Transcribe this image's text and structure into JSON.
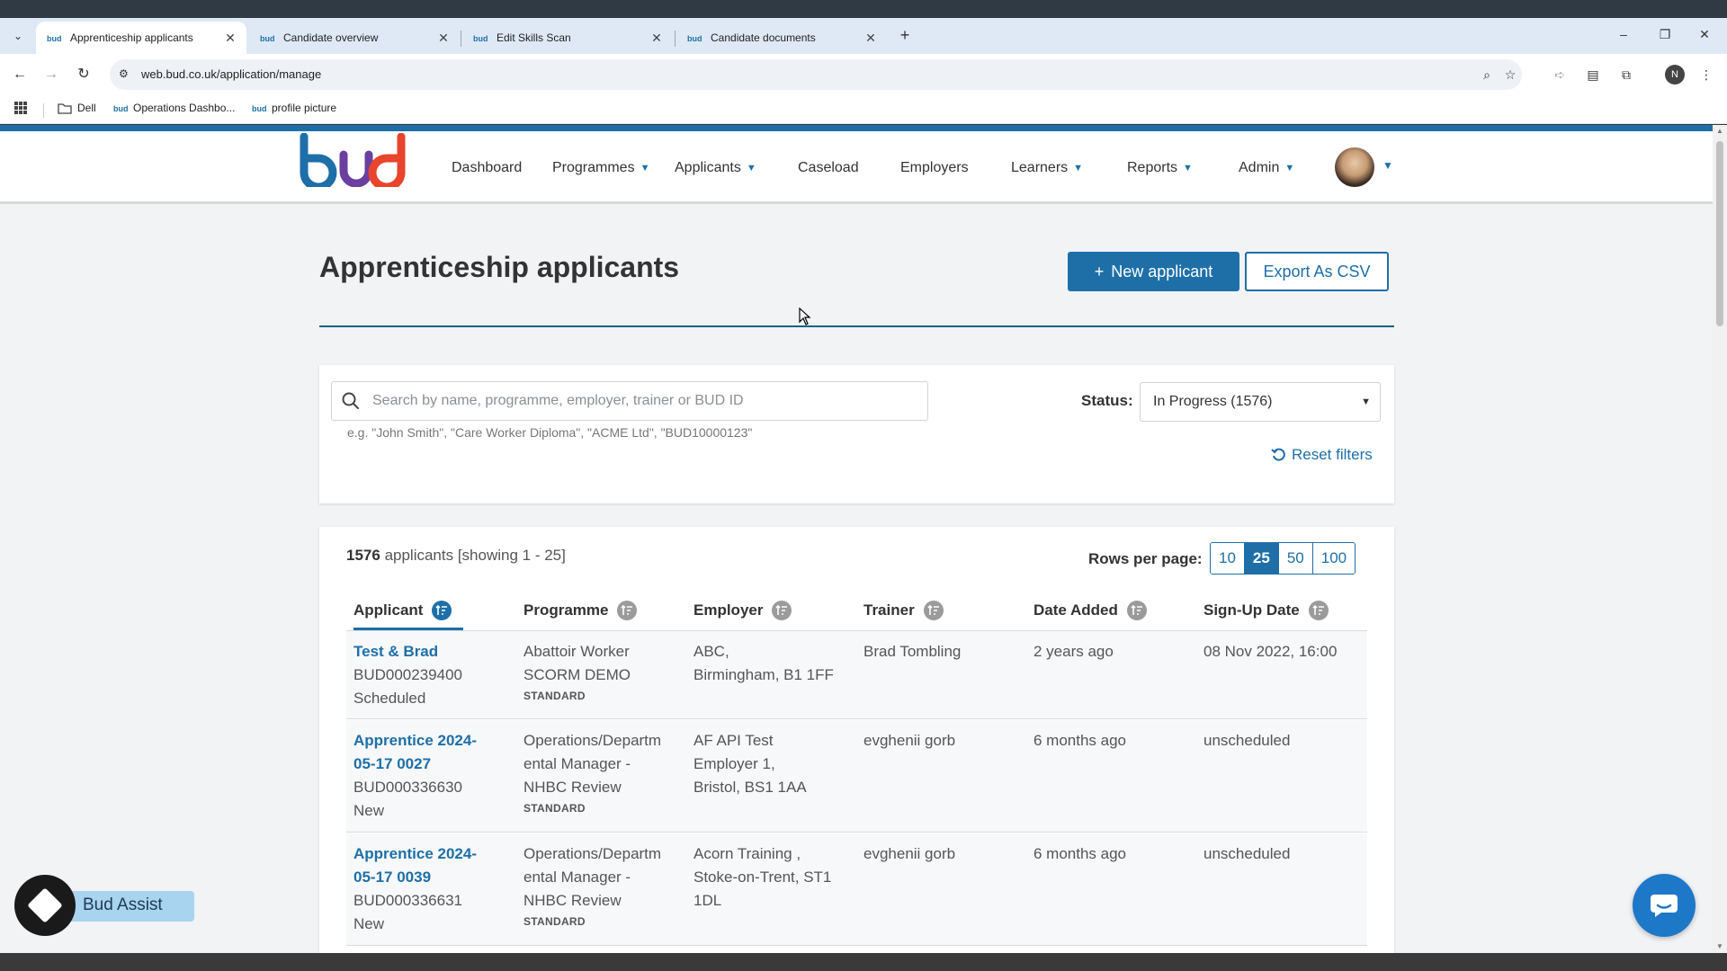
{
  "browser": {
    "tabs": [
      {
        "title": "Apprenticeship applicants",
        "active": true
      },
      {
        "title": "Candidate overview",
        "active": false
      },
      {
        "title": "Edit Skills Scan",
        "active": false
      },
      {
        "title": "Candidate documents",
        "active": false
      }
    ],
    "url": "web.bud.co.uk/application/manage",
    "profile_initial": "N",
    "bookmarks": [
      {
        "label": "Dell",
        "icon": "folder-icon"
      },
      {
        "label": "Operations Dashbo...",
        "icon": "bud-favicon"
      },
      {
        "label": "profile picture",
        "icon": "bud-favicon"
      }
    ]
  },
  "header": {
    "nav": [
      {
        "label": "Dashboard",
        "has_menu": false
      },
      {
        "label": "Programmes",
        "has_menu": true
      },
      {
        "label": "Applicants",
        "has_menu": true
      },
      {
        "label": "Caseload",
        "has_menu": false
      },
      {
        "label": "Employers",
        "has_menu": false
      },
      {
        "label": "Learners",
        "has_menu": true
      },
      {
        "label": "Reports",
        "has_menu": true
      },
      {
        "label": "Admin",
        "has_menu": true
      }
    ]
  },
  "page": {
    "title": "Apprenticeship applicants",
    "new_applicant": "New applicant",
    "export_csv": "Export As CSV"
  },
  "filters": {
    "search_placeholder": "Search by name, programme, employer, trainer or BUD ID",
    "search_value": "",
    "search_hint": "e.g. \"John Smith\", \"Care Worker Diploma\", \"ACME Ltd\", \"BUD10000123\"",
    "status_label": "Status:",
    "status_value": "In Progress (1576)",
    "reset_label": "Reset filters"
  },
  "table": {
    "count": "1576",
    "count_suffix": "applicants [showing 1 - 25]",
    "rows_per_page_label": "Rows per page:",
    "rows_per_page_options": [
      "10",
      "25",
      "50",
      "100"
    ],
    "rows_per_page_selected": "25",
    "columns": [
      "Applicant",
      "Programme",
      "Employer",
      "Trainer",
      "Date Added",
      "Sign-Up Date"
    ],
    "sorted_column": "Applicant",
    "rows": [
      {
        "applicant_lines": [
          "Test & Brad"
        ],
        "bud_id": "BUD000239400",
        "status": "Scheduled",
        "programme_lines": [
          "Abattoir Worker",
          "SCORM DEMO"
        ],
        "programme_tag": "STANDARD",
        "employer_lines": [
          "ABC,",
          "Birmingham, B1 1FF"
        ],
        "trainer": "Brad Tombling",
        "date_added": "2 years ago",
        "signup_date": "08 Nov 2022, 16:00"
      },
      {
        "applicant_lines": [
          "Apprentice 2024-",
          "05-17 0027"
        ],
        "bud_id": "BUD000336630",
        "status": "New",
        "programme_lines": [
          "Operations/Departm",
          "ental Manager -",
          "NHBC Review"
        ],
        "programme_tag": "STANDARD",
        "employer_lines": [
          "AF API Test",
          "Employer 1,",
          "Bristol, BS1 1AA"
        ],
        "trainer": "evghenii gorb",
        "date_added": "6 months ago",
        "signup_date": "unscheduled"
      },
      {
        "applicant_lines": [
          "Apprentice 2024-",
          "05-17 0039"
        ],
        "bud_id": "BUD000336631",
        "status": "New",
        "programme_lines": [
          "Operations/Departm",
          "ental Manager -",
          "NHBC Review"
        ],
        "programme_tag": "STANDARD",
        "employer_lines": [
          "Acorn Training ,",
          "Stoke-on-Trent, ST1",
          "1DL"
        ],
        "trainer": "evghenii gorb",
        "date_added": "6 months ago",
        "signup_date": "unscheduled"
      }
    ]
  },
  "widgets": {
    "assist_label": "Bud Assist"
  },
  "colors": {
    "brand_blue": "#1e6fa8",
    "page_bg": "#f2f3f5"
  }
}
